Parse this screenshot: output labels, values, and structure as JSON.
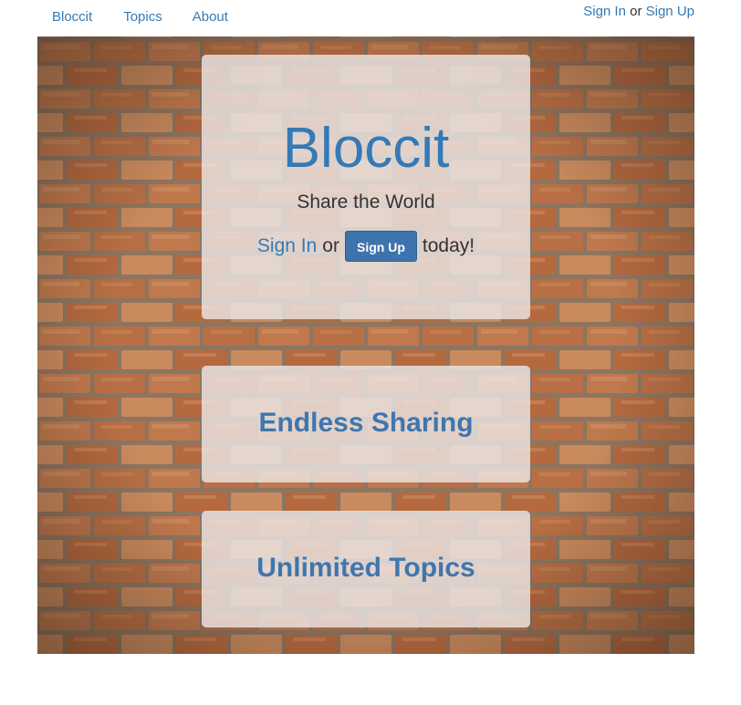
{
  "nav": {
    "brand": "Bloccit",
    "topics": "Topics",
    "about": "About",
    "sign_in": "Sign In",
    "or": "or",
    "sign_up": "Sign Up"
  },
  "hero": {
    "title": "Bloccit",
    "tagline": "Share the World",
    "sign_in": "Sign In",
    "or": "or",
    "sign_up_button": "Sign Up",
    "today": "today!"
  },
  "features": {
    "sharing": "Endless Sharing",
    "topics": "Unlimited Topics"
  },
  "colors": {
    "link": "#337ab7",
    "button": "#3e74ad",
    "text": "#333333"
  }
}
